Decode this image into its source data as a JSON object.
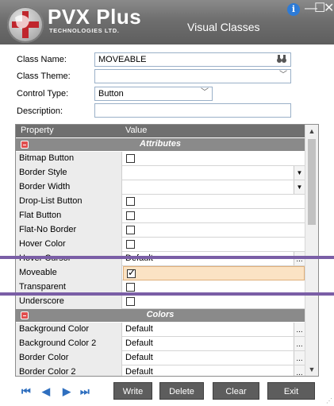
{
  "window": {
    "brand": "PVX Plus",
    "brand_sub": "TECHNOLOGIES LTD.",
    "title": "Visual Classes",
    "controls": [
      "info-icon",
      "minimize",
      "maximize",
      "close"
    ]
  },
  "form": {
    "class_name_label": "Class Name:",
    "class_name_value": "MOVEABLE",
    "class_theme_label": "Class Theme:",
    "class_theme_value": "",
    "control_type_label": "Control Type:",
    "control_type_value": "Button",
    "description_label": "Description:",
    "description_value": ""
  },
  "grid": {
    "headers": {
      "property": "Property",
      "value": "Value"
    },
    "section_attributes": "Attributes",
    "section_colors": "Colors",
    "attributes": [
      {
        "name": "Bitmap Button",
        "type": "check",
        "checked": false
      },
      {
        "name": "Border Style",
        "type": "dropdown",
        "value": ""
      },
      {
        "name": "Border Width",
        "type": "dropdown",
        "value": ""
      },
      {
        "name": "Drop-List Button",
        "type": "check",
        "checked": false
      },
      {
        "name": "Flat Button",
        "type": "check",
        "checked": false
      },
      {
        "name": "Flat-No Border",
        "type": "check",
        "checked": false
      },
      {
        "name": "Hover Color",
        "type": "check",
        "checked": false
      },
      {
        "name": "Hover Cursor",
        "type": "text",
        "value": "Default"
      },
      {
        "name": "Moveable",
        "type": "check",
        "checked": true
      },
      {
        "name": "Transparent",
        "type": "check",
        "checked": false
      },
      {
        "name": "Underscore",
        "type": "check",
        "checked": false
      }
    ],
    "colors": [
      {
        "name": "Background Color",
        "value": "Default"
      },
      {
        "name": "Background Color 2",
        "value": "Default"
      },
      {
        "name": "Border Color",
        "value": "Default"
      },
      {
        "name": "Border Color 2",
        "value": "Default"
      }
    ]
  },
  "toolbar": {
    "write": "Write",
    "delete": "Delete",
    "clear": "Clear",
    "exit": "Exit",
    "nav_icons": [
      "first-record-icon",
      "previous-record-icon",
      "next-record-icon",
      "last-record-icon"
    ]
  },
  "colors": {
    "titlebar": "#6e6e6e",
    "highlight_lines": "#7a5ea6",
    "accent_blue": "#2f6fbf"
  }
}
